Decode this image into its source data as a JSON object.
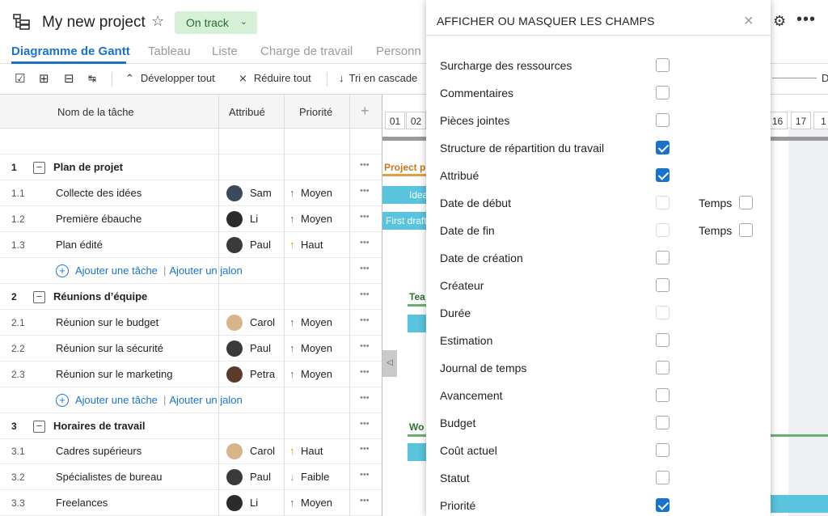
{
  "header": {
    "title": "My new project",
    "status": "On track"
  },
  "tabs": [
    {
      "label": "Diagramme de Gantt",
      "active": true
    },
    {
      "label": "Tableau"
    },
    {
      "label": "Liste"
    },
    {
      "label": "Charge de travail"
    },
    {
      "label": "Personn"
    }
  ],
  "toolbar": {
    "expand_label": "Développer tout",
    "collapse_label": "Réduire tout",
    "cascade_label": "Tri en cascade",
    "zoom_suffix": "D"
  },
  "grid": {
    "headers": {
      "name": "Nom de la tâche",
      "assigned": "Attribué",
      "priority": "Priorité",
      "add": "+"
    },
    "rows": [
      {
        "type": "group",
        "num": "1",
        "name": "Plan de projet"
      },
      {
        "type": "task",
        "num": "1.1",
        "name": "Collecte des idées",
        "assignee": "Sam",
        "priority": "Moyen",
        "prio_arrow": "↑"
      },
      {
        "type": "task",
        "num": "1.2",
        "name": "Première ébauche",
        "assignee": "Li",
        "priority": "Moyen",
        "prio_arrow": "↑"
      },
      {
        "type": "task",
        "num": "1.3",
        "name": "Plan édité",
        "assignee": "Paul",
        "priority": "Haut",
        "prio_arrow": "↑"
      },
      {
        "type": "add",
        "add_task": "Ajouter une tâche",
        "add_milestone": "Ajouter un jalon"
      },
      {
        "type": "group",
        "num": "2",
        "name": "Réunions d’équipe"
      },
      {
        "type": "task",
        "num": "2.1",
        "name": "Réunion sur le budget",
        "assignee": "Carol",
        "priority": "Moyen",
        "prio_arrow": "↑"
      },
      {
        "type": "task",
        "num": "2.2",
        "name": "Réunion sur la sécurité",
        "assignee": "Paul",
        "priority": "Moyen",
        "prio_arrow": "↑"
      },
      {
        "type": "task",
        "num": "2.3",
        "name": "Réunion sur le marketing",
        "assignee": "Petra",
        "priority": "Moyen",
        "prio_arrow": "↑"
      },
      {
        "type": "add",
        "add_task": "Ajouter une tâche",
        "add_milestone": "Ajouter un jalon"
      },
      {
        "type": "group",
        "num": "3",
        "name": "Horaires de travail"
      },
      {
        "type": "task",
        "num": "3.1",
        "name": "Cadres supérieurs",
        "assignee": "Carol",
        "priority": "Haut",
        "prio_arrow": "↑"
      },
      {
        "type": "task",
        "num": "3.2",
        "name": "Spécialistes de bureau",
        "assignee": "Paul",
        "priority": "Faible",
        "prio_arrow": "↓"
      },
      {
        "type": "task",
        "num": "3.3",
        "name": "Freelances",
        "assignee": "Li",
        "priority": "Moyen",
        "prio_arrow": "↑"
      }
    ]
  },
  "gantt": {
    "days_left": [
      "01",
      "02"
    ],
    "days_right": [
      "16",
      "17",
      "1"
    ],
    "bars": {
      "project_summary": "Project p",
      "ideas": "Idea",
      "first_draft": "First draft",
      "team_summary": "Tea",
      "work_summary": "Wo"
    }
  },
  "panel": {
    "title": "AFFICHER OU MASQUER LES CHAMPS",
    "fields": [
      {
        "label": "Surcharge des ressources",
        "checked": false
      },
      {
        "label": "Commentaires",
        "checked": false
      },
      {
        "label": "Pièces jointes",
        "checked": false
      },
      {
        "label": "Structure de répartition du travail",
        "checked": true
      },
      {
        "label": "Attribué",
        "checked": true
      },
      {
        "label": "Date de début",
        "checked": false,
        "disabled": true,
        "extra": "Temps"
      },
      {
        "label": "Date de fin",
        "checked": false,
        "disabled": true,
        "extra": "Temps"
      },
      {
        "label": "Date de création",
        "checked": false
      },
      {
        "label": "Créateur",
        "checked": false
      },
      {
        "label": "Durée",
        "checked": false,
        "disabled": true
      },
      {
        "label": "Estimation",
        "checked": false
      },
      {
        "label": "Journal de temps",
        "checked": false
      },
      {
        "label": "Avancement",
        "checked": false
      },
      {
        "label": "Budget",
        "checked": false
      },
      {
        "label": "Coût actuel",
        "checked": false
      },
      {
        "label": "Statut",
        "checked": false
      },
      {
        "label": "Priorité",
        "checked": true
      }
    ]
  },
  "colors": {
    "accent": "#1a73c8",
    "status_bg": "#d6f0d8",
    "bar": "#5ac3dd",
    "summary_project": "#e0a040",
    "summary_team": "#4a9a50",
    "prio_medium": "#2a8a4a",
    "prio_high": "#e08a1e",
    "prio_low": "#999999"
  }
}
